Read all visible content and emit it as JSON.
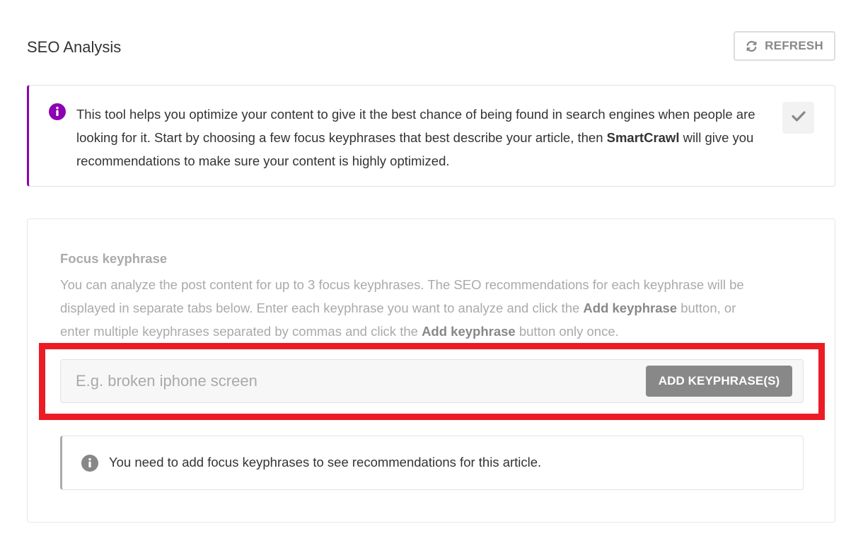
{
  "header": {
    "title": "SEO Analysis",
    "refresh_label": "REFRESH",
    "refresh_icon": "refresh-icon"
  },
  "notice": {
    "icon": "info-icon",
    "text_before": "This tool helps you optimize your content to give it the best chance of being found in search engines when people are looking for it. Start by choosing a few focus keyphrases that best describe your article, then ",
    "brand": "SmartCrawl",
    "text_after": " will give you recommendations to make sure your content is highly optimized.",
    "dismiss_icon": "checkmark-icon",
    "accent_color": "#8d00b1"
  },
  "focus": {
    "label": "Focus keyphrase",
    "desc_part1": "You can analyze the post content for up to 3 focus keyphrases. The SEO recommendations for each keyphrase will be displayed in separate tabs below. Enter each keyphrase you want to analyze and click the ",
    "desc_bold1": "Add keyphrase",
    "desc_part2": " button, or enter multiple keyphrases separated by commas and click the ",
    "desc_bold2": "Add keyphrase",
    "desc_part3": " button only once.",
    "input_value": "",
    "input_placeholder": "E.g. broken iphone screen",
    "add_button_label": "ADD KEYPHRASE(S)",
    "highlight_color": "#ec1c24"
  },
  "info": {
    "icon": "info-icon",
    "text": "You need to add focus keyphrases to see recommendations for this article."
  }
}
